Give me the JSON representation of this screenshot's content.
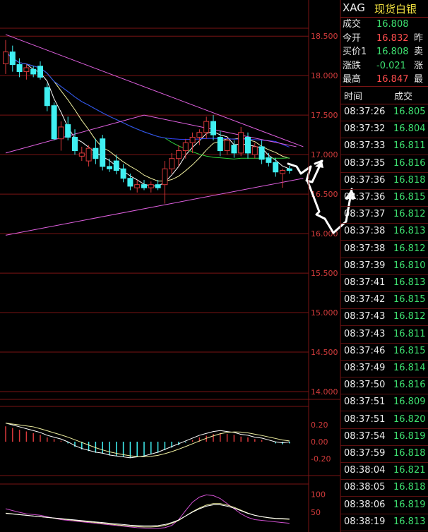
{
  "colors": {
    "up": "#d9383a",
    "down": "#40f0f2",
    "grid": "#7a1414",
    "ma_yellow": "#f0f0a0",
    "ma_white": "#ffffff",
    "ma_green": "#2fcf3a",
    "ma_blue": "#3344ff",
    "trendline": "#e060e0",
    "quote_green": "#3ee070",
    "quote_red": "#ff4d4d"
  },
  "header": {
    "symbol": "XAG",
    "name": "现货白银"
  },
  "quote": [
    {
      "label": "成交",
      "value": "16.808",
      "tail": ""
    },
    {
      "label": "今开",
      "value": "16.832",
      "tail": "昨"
    },
    {
      "label": "买价1",
      "value": "16.808",
      "tail": "卖"
    },
    {
      "label": "涨跌",
      "value": "-0.021",
      "tail": "涨"
    },
    {
      "label": "最高",
      "value": "16.847",
      "tail": "最"
    }
  ],
  "ticks_header": {
    "time": "时间",
    "price": "成交"
  },
  "ticks": [
    {
      "time": "08:37:26",
      "price": "16.805"
    },
    {
      "time": "08:37:32",
      "price": "16.804"
    },
    {
      "time": "08:37:33",
      "price": "16.811"
    },
    {
      "time": "08:37:35",
      "price": "16.816"
    },
    {
      "time": "08:37:36",
      "price": "16.818"
    },
    {
      "time": "08:37:36",
      "price": "16.815"
    },
    {
      "time": "08:37:37",
      "price": "16.812"
    },
    {
      "time": "08:37:38",
      "price": "16.813"
    },
    {
      "time": "08:37:38",
      "price": "16.812"
    },
    {
      "time": "08:37:39",
      "price": "16.810"
    },
    {
      "time": "08:37:41",
      "price": "16.813"
    },
    {
      "time": "08:37:42",
      "price": "16.815"
    },
    {
      "time": "08:37:43",
      "price": "16.812"
    },
    {
      "time": "08:37:43",
      "price": "16.811"
    },
    {
      "time": "08:37:46",
      "price": "16.815"
    },
    {
      "time": "08:37:49",
      "price": "16.814"
    },
    {
      "time": "08:37:50",
      "price": "16.816"
    },
    {
      "time": "08:37:51",
      "price": "16.809"
    },
    {
      "time": "08:37:51",
      "price": "16.820"
    },
    {
      "time": "08:37:54",
      "price": "16.819"
    },
    {
      "time": "08:37:59",
      "price": "16.818"
    },
    {
      "time": "08:38:04",
      "price": "16.821"
    },
    {
      "time": "08:38:05",
      "price": "16.818"
    },
    {
      "time": "08:38:06",
      "price": "16.819"
    },
    {
      "time": "08:38:19",
      "price": "16.813"
    }
  ],
  "chart_data": [
    {
      "type": "candlestick",
      "title": "",
      "y_ticks": [
        "18.500",
        "18.000",
        "17.500",
        "17.000",
        "16.500",
        "16.000",
        "15.500",
        "15.000",
        "14.500",
        "14.000"
      ],
      "ylim": [
        14.0,
        18.6
      ],
      "grid": true,
      "candles": [
        {
          "o": 18.15,
          "h": 18.45,
          "l": 18.02,
          "c": 18.3
        },
        {
          "o": 18.3,
          "h": 18.38,
          "l": 18.05,
          "c": 18.14
        },
        {
          "o": 18.14,
          "h": 18.22,
          "l": 17.98,
          "c": 18.05
        },
        {
          "o": 18.05,
          "h": 18.14,
          "l": 17.95,
          "c": 18.1
        },
        {
          "o": 18.08,
          "h": 18.12,
          "l": 17.98,
          "c": 18.02
        },
        {
          "o": 18.12,
          "h": 18.18,
          "l": 17.95,
          "c": 17.98
        },
        {
          "o": 17.85,
          "h": 17.9,
          "l": 17.55,
          "c": 17.62
        },
        {
          "o": 17.62,
          "h": 17.66,
          "l": 17.18,
          "c": 17.2
        },
        {
          "o": 17.2,
          "h": 17.42,
          "l": 17.05,
          "c": 17.35
        },
        {
          "o": 17.38,
          "h": 17.48,
          "l": 17.18,
          "c": 17.22
        },
        {
          "o": 17.22,
          "h": 17.32,
          "l": 17.0,
          "c": 17.05
        },
        {
          "o": 16.98,
          "h": 17.1,
          "l": 16.92,
          "c": 17.02
        },
        {
          "o": 16.92,
          "h": 17.12,
          "l": 16.85,
          "c": 17.08
        },
        {
          "o": 17.08,
          "h": 17.2,
          "l": 16.88,
          "c": 16.95
        },
        {
          "o": 17.2,
          "h": 17.25,
          "l": 16.8,
          "c": 16.85
        },
        {
          "o": 16.85,
          "h": 16.95,
          "l": 16.78,
          "c": 16.82
        },
        {
          "o": 16.92,
          "h": 17.0,
          "l": 16.75,
          "c": 16.8
        },
        {
          "o": 16.82,
          "h": 16.88,
          "l": 16.65,
          "c": 16.7
        },
        {
          "o": 16.7,
          "h": 16.76,
          "l": 16.55,
          "c": 16.6
        },
        {
          "o": 16.58,
          "h": 16.68,
          "l": 16.52,
          "c": 16.62
        },
        {
          "o": 16.62,
          "h": 16.68,
          "l": 16.55,
          "c": 16.58
        },
        {
          "o": 16.58,
          "h": 16.66,
          "l": 16.52,
          "c": 16.62
        },
        {
          "o": 16.62,
          "h": 16.68,
          "l": 16.55,
          "c": 16.58
        },
        {
          "o": 16.62,
          "h": 16.92,
          "l": 16.38,
          "c": 16.82
        },
        {
          "o": 16.82,
          "h": 17.02,
          "l": 16.76,
          "c": 16.95
        },
        {
          "o": 16.95,
          "h": 17.12,
          "l": 16.85,
          "c": 17.05
        },
        {
          "o": 17.05,
          "h": 17.2,
          "l": 16.95,
          "c": 17.15
        },
        {
          "o": 17.15,
          "h": 17.28,
          "l": 17.02,
          "c": 17.22
        },
        {
          "o": 17.22,
          "h": 17.32,
          "l": 17.12,
          "c": 17.28
        },
        {
          "o": 17.28,
          "h": 17.48,
          "l": 17.2,
          "c": 17.42
        },
        {
          "o": 17.42,
          "h": 17.5,
          "l": 17.18,
          "c": 17.25
        },
        {
          "o": 17.22,
          "h": 17.3,
          "l": 16.98,
          "c": 17.05
        },
        {
          "o": 17.05,
          "h": 17.22,
          "l": 17.0,
          "c": 17.18
        },
        {
          "o": 17.12,
          "h": 17.18,
          "l": 16.96,
          "c": 17.02
        },
        {
          "o": 17.02,
          "h": 17.35,
          "l": 16.98,
          "c": 17.28
        },
        {
          "o": 17.22,
          "h": 17.28,
          "l": 16.95,
          "c": 17.02
        },
        {
          "o": 17.0,
          "h": 17.15,
          "l": 16.95,
          "c": 17.1
        },
        {
          "o": 17.1,
          "h": 17.18,
          "l": 16.88,
          "c": 16.94
        },
        {
          "o": 16.96,
          "h": 17.02,
          "l": 16.85,
          "c": 16.9
        },
        {
          "o": 16.9,
          "h": 16.96,
          "l": 16.72,
          "c": 16.78
        },
        {
          "o": 16.76,
          "h": 16.82,
          "l": 16.58,
          "c": 16.8
        },
        {
          "o": 16.82,
          "h": 16.86,
          "l": 16.76,
          "c": 16.8
        }
      ],
      "trendlines": [
        {
          "from": [
            0,
            18.52
          ],
          "to": [
            43,
            17.1
          ]
        },
        {
          "from": [
            0,
            15.98
          ],
          "to": [
            43,
            16.7
          ]
        },
        {
          "from": [
            0,
            17.02
          ],
          "to": [
            20,
            17.5
          ]
        },
        {
          "from": [
            20,
            17.5
          ],
          "to": [
            42,
            17.1
          ]
        }
      ]
    },
    {
      "type": "bar",
      "title": "",
      "y_ticks": [
        "0.20",
        "0.00",
        "-0.20"
      ],
      "ylim": [
        -0.38,
        0.38
      ],
      "values": [
        0.18,
        0.16,
        0.14,
        0.12,
        0.1,
        0.08,
        0.05,
        0.03,
        0.01,
        -0.02,
        -0.06,
        -0.09,
        -0.11,
        -0.13,
        -0.14,
        -0.16,
        -0.17,
        -0.18,
        -0.19,
        -0.18,
        -0.17,
        -0.15,
        -0.13,
        -0.1,
        -0.07,
        -0.04,
        -0.01,
        0.02,
        0.05,
        0.07,
        0.09,
        0.1,
        0.09,
        0.08,
        0.06,
        0.05,
        0.03,
        0.02,
        0.0,
        -0.02,
        -0.03,
        -0.02
      ]
    },
    {
      "type": "line",
      "title": "",
      "y_ticks": [
        "100",
        "50"
      ],
      "ylim": [
        0,
        120
      ],
      "series_a": [
        60,
        55,
        50,
        46,
        44,
        42,
        38,
        34,
        30,
        28,
        26,
        24,
        22,
        20,
        18,
        16,
        14,
        12,
        10,
        8,
        7,
        6,
        6,
        8,
        14,
        30,
        55,
        78,
        92,
        98,
        96,
        88,
        74,
        60,
        46,
        36,
        30,
        28,
        26,
        24,
        22,
        20
      ],
      "series_b": [
        48,
        46,
        44,
        42,
        40,
        38,
        36,
        34,
        32,
        30,
        28,
        26,
        24,
        22,
        20,
        18,
        16,
        14,
        12,
        11,
        10,
        10,
        11,
        14,
        20,
        28,
        40,
        52,
        62,
        70,
        74,
        74,
        70,
        64,
        56,
        48,
        42,
        38,
        35,
        33,
        32,
        31
      ]
    }
  ]
}
